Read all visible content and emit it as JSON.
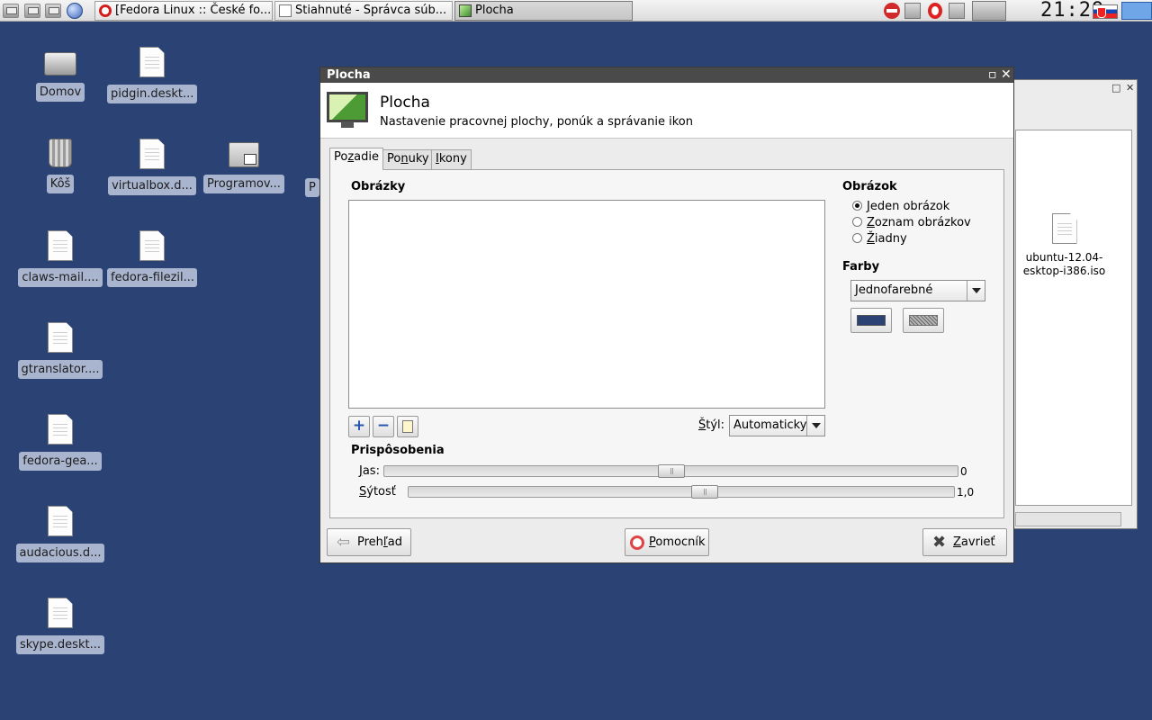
{
  "taskbar": {
    "tasks": [
      {
        "label": "[Fedora Linux :: České fo..."
      },
      {
        "label": "Stiahnuté - Správca súb..."
      },
      {
        "label": "Plocha"
      }
    ],
    "clock": "21:29"
  },
  "desktop": {
    "icons": [
      {
        "label": "Domov",
        "icon": "home-drive-icon"
      },
      {
        "label": "pidgin.deskt...",
        "icon": "document-icon"
      },
      {
        "label": "Kôš",
        "icon": "trash-icon"
      },
      {
        "label": "virtualbox.d...",
        "icon": "document-icon"
      },
      {
        "label": "Programov...",
        "icon": "shortcut-icon"
      },
      {
        "label": "P",
        "icon": "document-icon"
      },
      {
        "label": "claws-mail....",
        "icon": "document-icon"
      },
      {
        "label": "fedora-filezil...",
        "icon": "document-icon"
      },
      {
        "label": "gtranslator....",
        "icon": "document-icon"
      },
      {
        "label": "fedora-gea...",
        "icon": "document-icon"
      },
      {
        "label": "audacious.d...",
        "icon": "document-icon"
      },
      {
        "label": "skype.deskt...",
        "icon": "document-icon"
      }
    ]
  },
  "background_window": {
    "file_label": "ubuntu-12.04-\nesktop-i386.iso"
  },
  "dialog": {
    "title": "Plocha",
    "header_title": "Plocha",
    "header_subtitle": "Nastavenie pracovnej plochy, ponúk a správanie ikon",
    "tabs": [
      {
        "label_pre": "Po",
        "label_u": "z",
        "label_post": "adie"
      },
      {
        "label_pre": "Po",
        "label_u": "n",
        "label_post": "uky"
      },
      {
        "label_pre": "",
        "label_u": "I",
        "label_post": "kony"
      }
    ],
    "images_section": "Obrázky",
    "style_label_u": "Š",
    "style_label_rest": "týl:",
    "style_value": "Automaticky",
    "image_section": "Obrázok",
    "image_options": [
      {
        "u": "J",
        "rest": "eden obrázok",
        "selected": true
      },
      {
        "u": "Z",
        "rest": "oznam obrázkov",
        "selected": false
      },
      {
        "u": "Ž",
        "rest": "iadny",
        "selected": false
      }
    ],
    "colors_section": "Farby",
    "colors_value": "Jednofarebné",
    "color_primary": "#2b4274",
    "adjust_section": "Prispôsobenia",
    "brightness_u": "J",
    "brightness_rest": "as:",
    "brightness_value": "0",
    "brightness_level": 0.5,
    "saturation_u": "S",
    "saturation_rest": "ýtosť",
    "saturation_value": "1,0",
    "saturation_level": 0.545,
    "buttons": {
      "overview_pre": "Preh",
      "overview_u": "ľ",
      "overview_post": "ad",
      "help_u": "P",
      "help_rest": "omocník",
      "close_u": "Z",
      "close_rest": "avrieť"
    }
  }
}
